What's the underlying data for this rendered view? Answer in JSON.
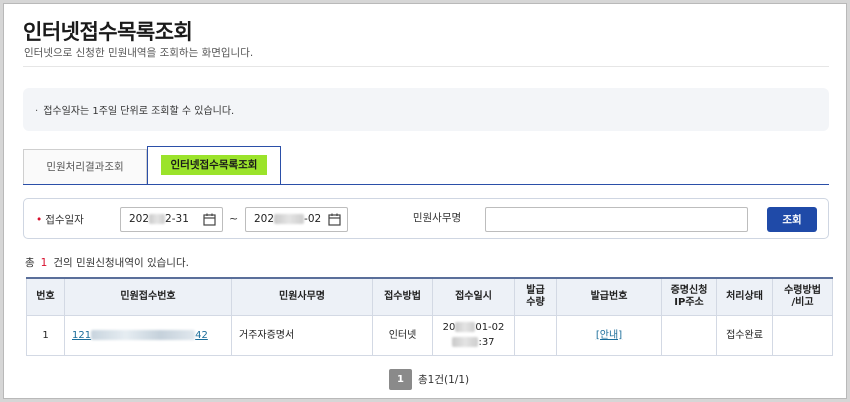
{
  "header": {
    "title": "인터넷접수목록조회",
    "description": "인터넷으로 신청한 민원내역을 조회하는 화면입니다."
  },
  "notice": {
    "bullet": "·",
    "text": "접수일자는 1주일 단위로 조회할 수 있습니다."
  },
  "tabs": [
    {
      "label": "민원처리결과조회",
      "active": false
    },
    {
      "label": "인터넷접수목록조회",
      "active": true
    }
  ],
  "search": {
    "date_label": "접수일자",
    "required_mark": "•",
    "date_from_prefix": "202",
    "date_from_suffix": "2-31",
    "date_separator": "~",
    "date_to_prefix": "202",
    "date_to_suffix": "-02",
    "office_label": "민원사무명",
    "office_value": "",
    "button_label": "조회"
  },
  "result": {
    "prefix": "총",
    "count": "1",
    "suffix": "건의 민원신청내역이 있습니다."
  },
  "table": {
    "headers": [
      "번호",
      "민원접수번호",
      "민원사무명",
      "접수방법",
      "접수일시",
      "발급\n수량",
      "발급번호",
      "증명신청\nIP주소",
      "처리상태",
      "수령방법\n/비고"
    ],
    "rows": [
      {
        "no": "1",
        "receipt_prefix": "121",
        "receipt_suffix": "42",
        "office": "거주자증명서",
        "method": "인터넷",
        "datetime_line1_prefix": "20",
        "datetime_line1_suffix": "01-02",
        "datetime_line2_suffix": ":37",
        "quantity": "",
        "issue_no": "[안내]",
        "ip": "",
        "status": "접수완료",
        "receive": ""
      }
    ]
  },
  "pager": {
    "current": "1",
    "info": "총1건(1/1)"
  },
  "colors": {
    "accent": "#1f4aa8",
    "tab_highlight": "#9be32b",
    "required": "#d8102e",
    "link": "#1b6d9a"
  }
}
